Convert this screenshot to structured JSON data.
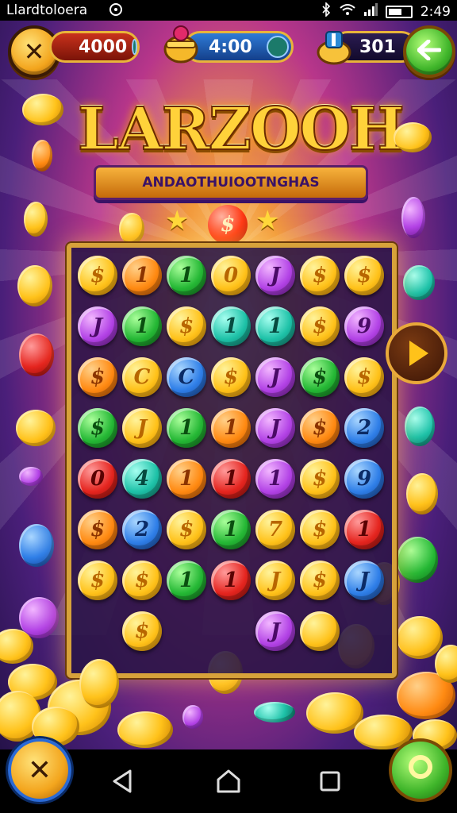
{
  "status_bar": {
    "app_name": "Llardtoloera",
    "time": "2:49",
    "icons": [
      "app-icon",
      "bluetooth-icon",
      "wifi-icon",
      "signal-icon",
      "battery-icon"
    ]
  },
  "hud": {
    "close_button": {
      "icon": "close-x-icon"
    },
    "coins": {
      "value": "4000",
      "icon": "coin-icon"
    },
    "timer": {
      "value": "4:00",
      "icon": "treasure-pot-icon",
      "badge_icon": "coin-icon"
    },
    "gems": {
      "value": "301",
      "icon": "coin-bag-icon"
    },
    "back_button": {
      "icon": "back-arrow-icon"
    }
  },
  "logo": {
    "title": "LARZOOH",
    "subtitle": "ANDAOTHUIOOTNGHAS"
  },
  "board": {
    "top_coin_glyph": "$",
    "rows": [
      [
        {
          "c": "gold",
          "g": "$"
        },
        {
          "c": "orange",
          "g": "1"
        },
        {
          "c": "green",
          "g": "1"
        },
        {
          "c": "gold",
          "g": "0"
        },
        {
          "c": "purple",
          "g": "J"
        },
        {
          "c": "gold",
          "g": "$"
        },
        {
          "c": "gold",
          "g": "$"
        }
      ],
      [
        {
          "c": "purple",
          "g": "J"
        },
        {
          "c": "green",
          "g": "1"
        },
        {
          "c": "gold",
          "g": "$"
        },
        {
          "c": "teal",
          "g": "1"
        },
        {
          "c": "teal",
          "g": "1"
        },
        {
          "c": "gold",
          "g": "$"
        },
        {
          "c": "purple",
          "g": "9"
        }
      ],
      [
        {
          "c": "orange",
          "g": "$"
        },
        {
          "c": "gold",
          "g": "C"
        },
        {
          "c": "blue",
          "g": "C"
        },
        {
          "c": "gold",
          "g": "$"
        },
        {
          "c": "purple",
          "g": "J"
        },
        {
          "c": "green",
          "g": "$"
        },
        {
          "c": "gold",
          "g": "$"
        }
      ],
      [
        {
          "c": "green",
          "g": "$"
        },
        {
          "c": "gold",
          "g": "J"
        },
        {
          "c": "green",
          "g": "1"
        },
        {
          "c": "orange",
          "g": "1"
        },
        {
          "c": "purple",
          "g": "J"
        },
        {
          "c": "orange",
          "g": "$"
        },
        {
          "c": "blue",
          "g": "2"
        }
      ],
      [
        {
          "c": "red",
          "g": "0"
        },
        {
          "c": "teal",
          "g": "4"
        },
        {
          "c": "orange",
          "g": "1"
        },
        {
          "c": "red",
          "g": "1"
        },
        {
          "c": "purple",
          "g": "1"
        },
        {
          "c": "gold",
          "g": "$"
        },
        {
          "c": "blue",
          "g": "9"
        }
      ],
      [
        {
          "c": "orange",
          "g": "$"
        },
        {
          "c": "blue",
          "g": "2"
        },
        {
          "c": "gold",
          "g": "$"
        },
        {
          "c": "green",
          "g": "1"
        },
        {
          "c": "gold",
          "g": "7"
        },
        {
          "c": "gold",
          "g": "$"
        },
        {
          "c": "red",
          "g": "1"
        }
      ],
      [
        {
          "c": "gold",
          "g": "$"
        },
        {
          "c": "gold",
          "g": "$"
        },
        {
          "c": "green",
          "g": "1"
        },
        {
          "c": "red",
          "g": "1"
        },
        {
          "c": "gold",
          "g": "J"
        },
        {
          "c": "gold",
          "g": "$"
        },
        {
          "c": "blue",
          "g": "J"
        }
      ],
      [
        {
          "c": "",
          "g": ""
        },
        {
          "c": "gold",
          "g": "$"
        },
        {
          "c": "",
          "g": ""
        },
        {
          "c": "",
          "g": ""
        },
        {
          "c": "purple",
          "g": "J"
        },
        {
          "c": "gold",
          "g": ""
        },
        {
          "c": "",
          "g": ""
        }
      ]
    ]
  },
  "side": {
    "play_button": {
      "icon": "play-icon"
    }
  },
  "bottom": {
    "left_button": {
      "icon": "close-x-icon"
    },
    "right_button": {
      "icon": "ring-icon"
    },
    "nav": [
      "back-nav-icon",
      "home-nav-icon",
      "recents-nav-icon"
    ]
  },
  "colors": {
    "gold": "#ffc21a",
    "orange": "#ff8a12",
    "green": "#25b835",
    "purple": "#b343e6",
    "teal": "#1ec2a8",
    "blue": "#2f7fe8",
    "red": "#e5251f",
    "frame": "#d7a23a"
  }
}
